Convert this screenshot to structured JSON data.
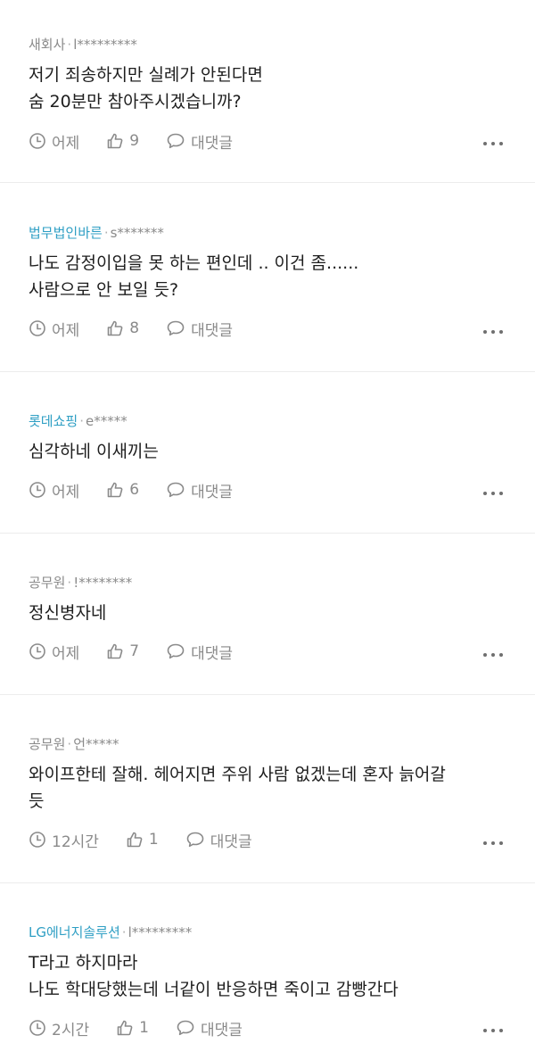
{
  "comments": [
    {
      "company": "새회사",
      "company_color": "#8a8a8a",
      "user": "l*********",
      "lines": [
        "저기 죄송하지만 실례가 안된다면",
        "숨 20분만 참아주시겠습니까?"
      ],
      "time": "어제",
      "likes": "9",
      "reply_label": "대댓글"
    },
    {
      "company": "법무법인바른",
      "company_color": "#2f9fc4",
      "user": "s*******",
      "lines": [
        "나도 감정이입을 못 하는 편인데 .. 이건 좀......",
        "사람으로 안 보일 듯?"
      ],
      "time": "어제",
      "likes": "8",
      "reply_label": "대댓글"
    },
    {
      "company": "롯데쇼핑",
      "company_color": "#2f9fc4",
      "user": "e*****",
      "lines": [
        "심각하네 이새끼는"
      ],
      "time": "어제",
      "likes": "6",
      "reply_label": "대댓글"
    },
    {
      "company": "공무원",
      "company_color": "#8a8a8a",
      "user": "!********",
      "lines": [
        "정신병자네"
      ],
      "time": "어제",
      "likes": "7",
      "reply_label": "대댓글"
    },
    {
      "company": "공무원",
      "company_color": "#8a8a8a",
      "user": "언*****",
      "lines": [
        "와이프한테 잘해. 헤어지면 주위 사람 없겠는데 혼자 늙어갈",
        "듯"
      ],
      "time": "12시간",
      "likes": "1",
      "reply_label": "대댓글"
    },
    {
      "company": "LG에너지솔루션",
      "company_color": "#2f9fc4",
      "user": "l*********",
      "lines": [
        "T라고 하지마라",
        "나도 학대당했는데 너같이 반응하면 죽이고 감빵간다"
      ],
      "time": "2시간",
      "likes": "1",
      "reply_label": "대댓글"
    }
  ],
  "icons": {
    "time": "clock-icon",
    "like": "thumbs-up-icon",
    "reply": "speech-bubble-icon",
    "more": "more-dots-icon"
  }
}
